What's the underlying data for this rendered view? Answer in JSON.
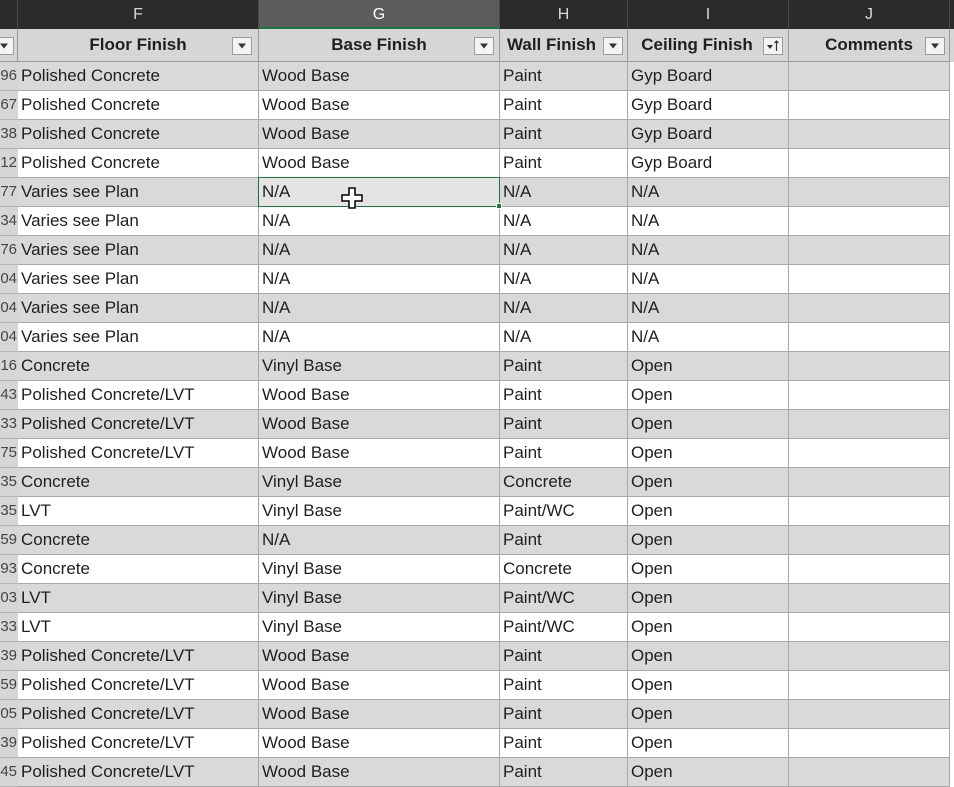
{
  "columns": [
    {
      "letter": "F",
      "header": "Floor Finish",
      "filter": "dropdown"
    },
    {
      "letter": "G",
      "header": "Base Finish",
      "filter": "dropdown",
      "active": true
    },
    {
      "letter": "H",
      "header": "Wall Finish",
      "filter": "dropdown"
    },
    {
      "letter": "I",
      "header": "Ceiling Finish",
      "filter": "sorted-ascending"
    },
    {
      "letter": "J",
      "header": "Comments",
      "filter": "dropdown"
    }
  ],
  "rows": [
    {
      "num": "96",
      "cells": [
        "Polished Concrete",
        "Wood Base",
        "Paint",
        "Gyp Board",
        ""
      ]
    },
    {
      "num": "67",
      "cells": [
        "Polished Concrete",
        "Wood Base",
        "Paint",
        "Gyp Board",
        ""
      ]
    },
    {
      "num": "38",
      "cells": [
        "Polished Concrete",
        "Wood Base",
        "Paint",
        "Gyp Board",
        ""
      ]
    },
    {
      "num": "12",
      "cells": [
        "Polished Concrete",
        "Wood Base",
        "Paint",
        "Gyp Board",
        ""
      ]
    },
    {
      "num": "77",
      "cells": [
        "Varies see Plan",
        "N/A",
        "N/A",
        "N/A",
        ""
      ]
    },
    {
      "num": "34",
      "cells": [
        "Varies see Plan",
        "N/A",
        "N/A",
        "N/A",
        ""
      ]
    },
    {
      "num": "76",
      "cells": [
        "Varies see Plan",
        "N/A",
        "N/A",
        "N/A",
        ""
      ]
    },
    {
      "num": "04",
      "cells": [
        "Varies see Plan",
        "N/A",
        "N/A",
        "N/A",
        ""
      ]
    },
    {
      "num": "04",
      "cells": [
        "Varies see Plan",
        "N/A",
        "N/A",
        "N/A",
        ""
      ]
    },
    {
      "num": "04",
      "cells": [
        "Varies see Plan",
        "N/A",
        "N/A",
        "N/A",
        ""
      ]
    },
    {
      "num": "16",
      "cells": [
        "Concrete",
        "Vinyl Base",
        "Paint",
        "Open",
        ""
      ]
    },
    {
      "num": "43",
      "cells": [
        "Polished Concrete/LVT",
        "Wood Base",
        "Paint",
        "Open",
        ""
      ]
    },
    {
      "num": "33",
      "cells": [
        "Polished Concrete/LVT",
        "Wood Base",
        "Paint",
        "Open",
        ""
      ]
    },
    {
      "num": "75",
      "cells": [
        "Polished Concrete/LVT",
        "Wood Base",
        "Paint",
        "Open",
        ""
      ]
    },
    {
      "num": "35",
      "cells": [
        "Concrete",
        "Vinyl Base",
        "Concrete",
        "Open",
        ""
      ]
    },
    {
      "num": "35",
      "cells": [
        "LVT",
        "Vinyl Base",
        "Paint/WC",
        "Open",
        ""
      ]
    },
    {
      "num": "59",
      "cells": [
        "Concrete",
        "N/A",
        "Paint",
        "Open",
        ""
      ]
    },
    {
      "num": "93",
      "cells": [
        "Concrete",
        "Vinyl Base",
        "Concrete",
        "Open",
        ""
      ]
    },
    {
      "num": "03",
      "cells": [
        "LVT",
        "Vinyl Base",
        "Paint/WC",
        "Open",
        ""
      ]
    },
    {
      "num": "33",
      "cells": [
        "LVT",
        "Vinyl Base",
        "Paint/WC",
        "Open",
        ""
      ]
    },
    {
      "num": "39",
      "cells": [
        "Polished Concrete/LVT",
        "Wood Base",
        "Paint",
        "Open",
        ""
      ]
    },
    {
      "num": "59",
      "cells": [
        "Polished Concrete/LVT",
        "Wood Base",
        "Paint",
        "Open",
        ""
      ]
    },
    {
      "num": "05",
      "cells": [
        "Polished Concrete/LVT",
        "Wood Base",
        "Paint",
        "Open",
        ""
      ]
    },
    {
      "num": "39",
      "cells": [
        "Polished Concrete/LVT",
        "Wood Base",
        "Paint",
        "Open",
        ""
      ]
    },
    {
      "num": "45",
      "cells": [
        "Polished Concrete/LVT",
        "Wood Base",
        "Paint",
        "Open",
        ""
      ]
    }
  ],
  "selected_cell": {
    "row": 4,
    "col": 1
  },
  "colors": {
    "banded_row": "#d9d9d9",
    "header_bg": "#d6d6d6",
    "selection": "#217346",
    "column_bar": "#2b2b2b"
  },
  "icons": {
    "filter": "dropdown-arrow-icon",
    "sort": "sort-ascending-filter-icon",
    "pointer": "crosshair-cursor-icon"
  }
}
